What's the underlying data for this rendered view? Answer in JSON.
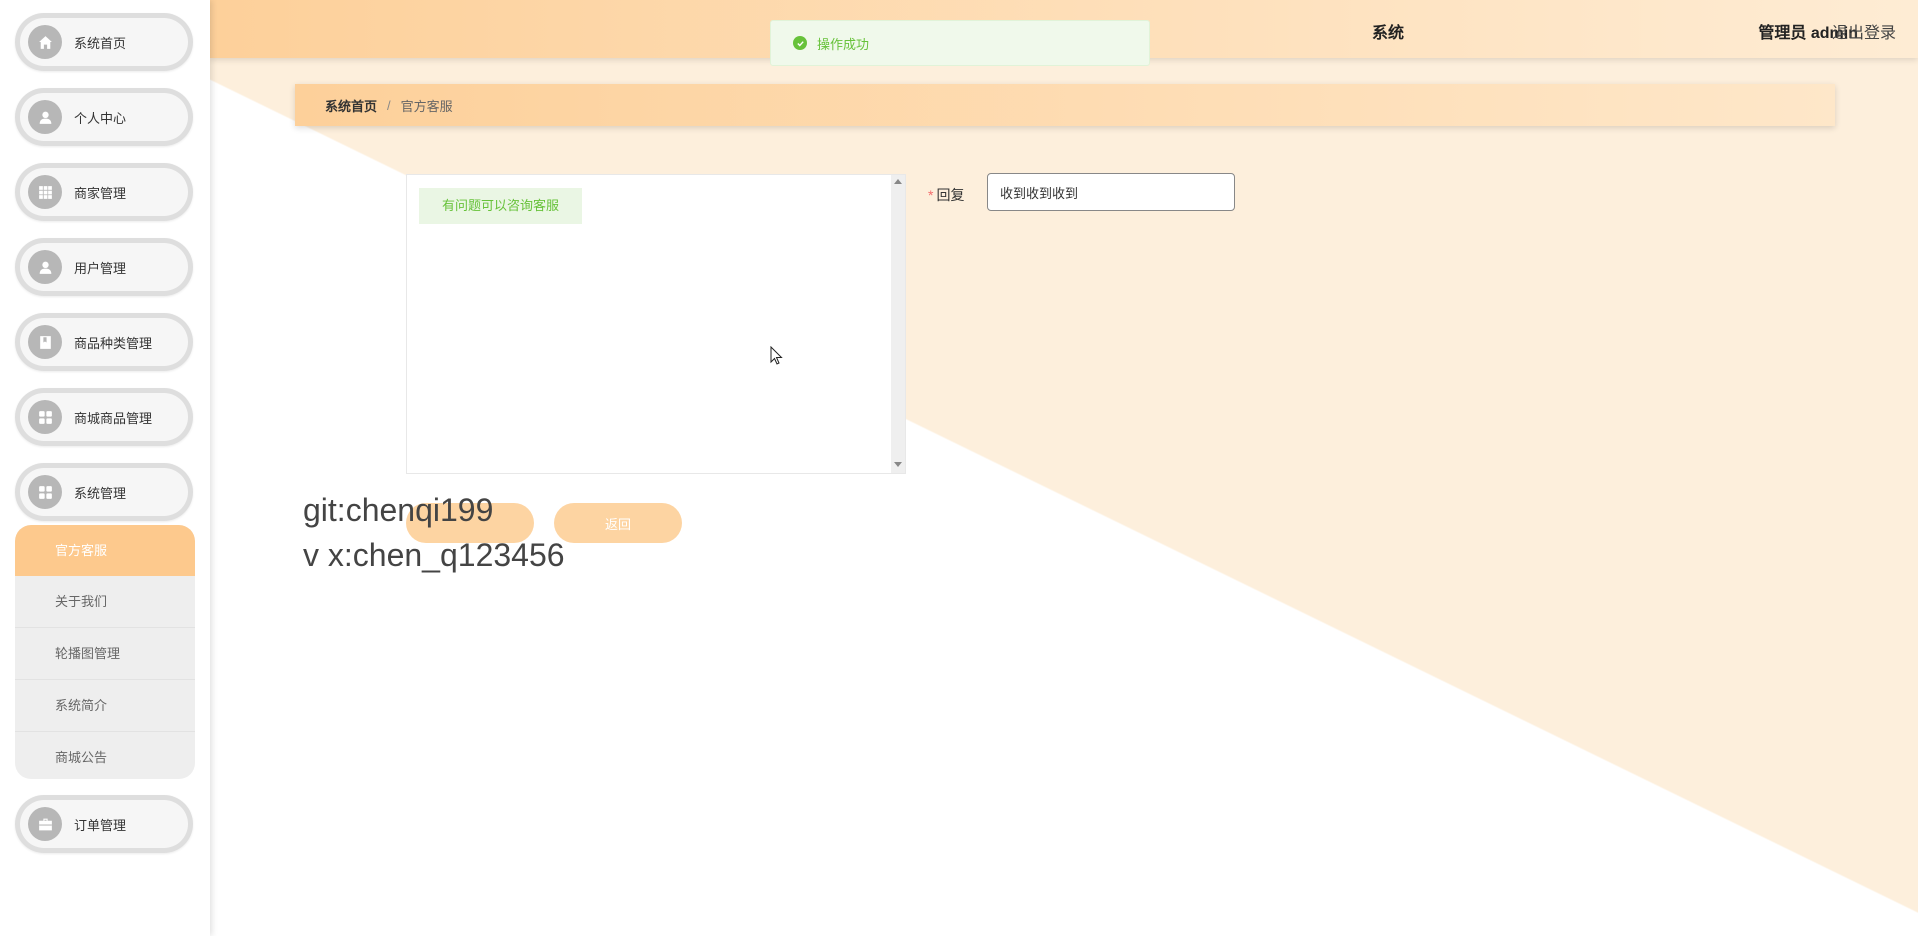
{
  "header": {
    "app_title": "系统",
    "user": "管理员 admin",
    "logout": "退出登录"
  },
  "toast": {
    "message": "操作成功",
    "status_color": "#67c23a"
  },
  "sidebar": {
    "items": [
      {
        "label": "系统首页",
        "icon": "home-icon"
      },
      {
        "label": "个人中心",
        "icon": "user-icon"
      },
      {
        "label": "商家管理",
        "icon": "grid-icon"
      },
      {
        "label": "用户管理",
        "icon": "user-icon"
      },
      {
        "label": "商品种类管理",
        "icon": "book-icon"
      },
      {
        "label": "商城商品管理",
        "icon": "apps-icon"
      },
      {
        "label": "系统管理",
        "icon": "apps-icon"
      },
      {
        "label": "订单管理",
        "icon": "briefcase-icon"
      }
    ],
    "submenu": [
      {
        "label": "官方客服",
        "active": true
      },
      {
        "label": "关于我们"
      },
      {
        "label": "轮播图管理"
      },
      {
        "label": "系统简介"
      },
      {
        "label": "商城公告"
      }
    ]
  },
  "breadcrumb": {
    "home": "系统首页",
    "separator": "/",
    "current": "官方客服"
  },
  "chat": {
    "message": "有问题可以咨询客服"
  },
  "form": {
    "reply_required": "*",
    "reply_label": "回复",
    "reply_value": "收到收到收到"
  },
  "buttons": {
    "submit": "",
    "back": "返回"
  },
  "watermark": {
    "line1": "git:chenqi199",
    "line2": "v x:chen_q123456"
  },
  "colors": {
    "accent": "#fdc98d",
    "header_start": "#fdd09a",
    "header_end": "#feecd4",
    "success": "#67c23a"
  }
}
